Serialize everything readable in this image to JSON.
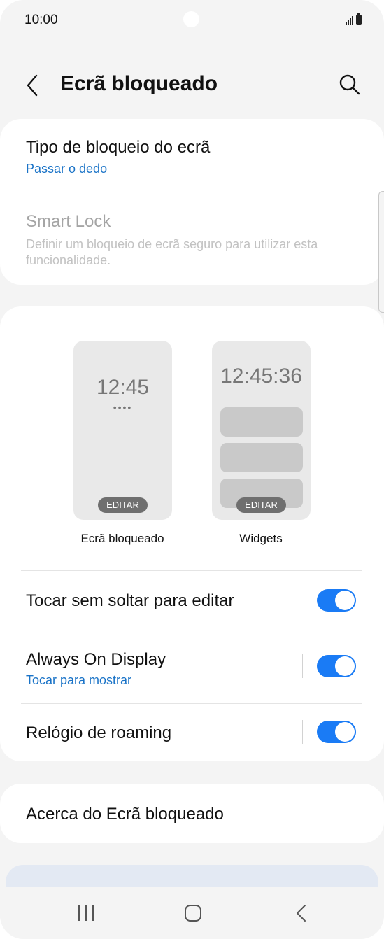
{
  "status": {
    "time": "10:00"
  },
  "header": {
    "title": "Ecrã bloqueado",
    "back_icon": "chevron-left-icon",
    "search_icon": "search-icon"
  },
  "lock_type": {
    "title": "Tipo de bloqueio do ecrã",
    "value": "Passar o dedo"
  },
  "smart_lock": {
    "title": "Smart Lock",
    "description": "Definir um bloqueio de ecrã seguro para utilizar esta funcionalidade."
  },
  "previews": {
    "lock": {
      "time": "12:45",
      "dots": "••••",
      "edit": "EDITAR",
      "label": "Ecrã bloqueado"
    },
    "widgets": {
      "time": "12:45:36",
      "edit": "EDITAR",
      "label": "Widgets"
    }
  },
  "settings": {
    "touch_hold": {
      "label": "Tocar sem soltar para editar",
      "enabled": true
    },
    "aod": {
      "label": "Always On Display",
      "sub": "Tocar para mostrar",
      "enabled": true
    },
    "roaming": {
      "label": "Relógio de roaming",
      "enabled": true
    }
  },
  "about": {
    "label": "Acerca do Ecrã bloqueado"
  },
  "colors": {
    "accent": "#1a7bf5",
    "link": "#1a73c7",
    "background": "#f4f4f4",
    "card": "#ffffff"
  },
  "navbar": {
    "recents_icon": "recents-icon",
    "home_icon": "home-icon",
    "back_icon": "back-icon"
  }
}
